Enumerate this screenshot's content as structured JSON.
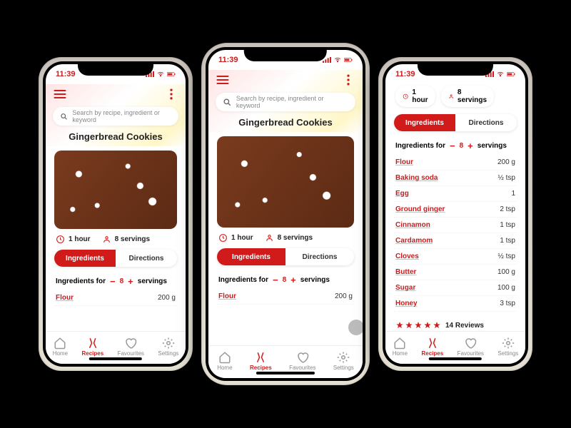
{
  "status": {
    "time": "11:39"
  },
  "search": {
    "placeholder": "Search by recipe, ingredient or keyword"
  },
  "recipe": {
    "title": "Gingerbread Cookies",
    "duration": "1 hour",
    "servings_label": "8 servings",
    "servings_count": "8",
    "servings_prefix": "Ingredients for",
    "servings_suffix": "servings"
  },
  "tabs": {
    "ingredients": "Ingredients",
    "directions": "Directions"
  },
  "ingredients": [
    {
      "name": "Flour",
      "amount": "200 g"
    },
    {
      "name": "Baking soda",
      "amount": "½ tsp"
    },
    {
      "name": "Egg",
      "amount": "1"
    },
    {
      "name": "Ground ginger",
      "amount": "2 tsp"
    },
    {
      "name": "Cinnamon",
      "amount": "1 tsp"
    },
    {
      "name": "Cardamom",
      "amount": "1 tsp"
    },
    {
      "name": "Cloves",
      "amount": "½ tsp"
    },
    {
      "name": "Butter",
      "amount": "100 g"
    },
    {
      "name": "Sugar",
      "amount": "100 g"
    },
    {
      "name": "Honey",
      "amount": "3 tsp"
    }
  ],
  "reviews": {
    "count_label": "14 Reviews"
  },
  "nav": {
    "home": "Home",
    "recipes": "Recipes",
    "favourites": "Favourites",
    "settings": "Settings"
  },
  "colors": {
    "accent": "#d11a1a"
  }
}
